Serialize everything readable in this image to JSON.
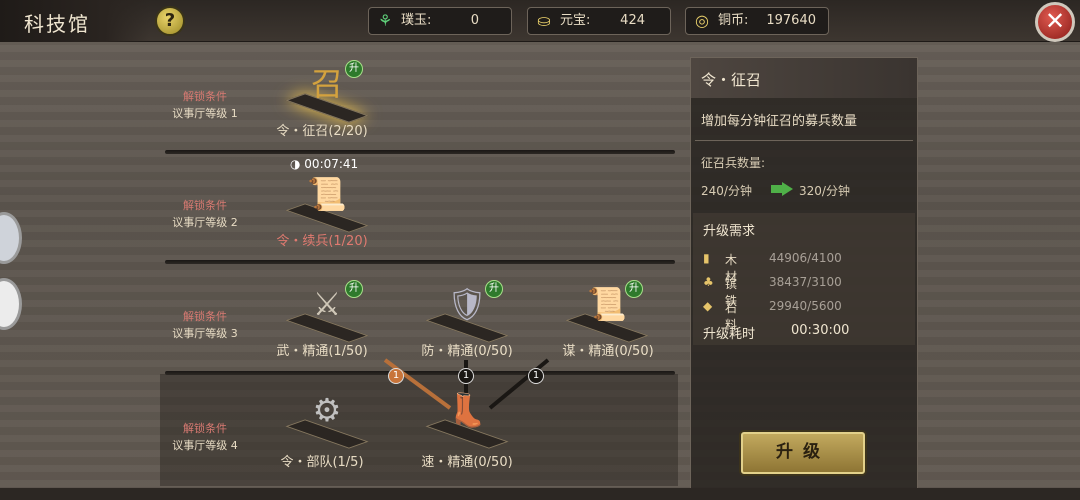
{
  "header": {
    "title": "科技馆",
    "help_label": "?",
    "close_label": "✕"
  },
  "resources": [
    {
      "icon": "jade-icon",
      "glyph": "⚘",
      "label": "璞玉:",
      "value": "0"
    },
    {
      "icon": "ingot-icon",
      "glyph": "⛀",
      "label": "元宝:",
      "value": "424"
    },
    {
      "icon": "copper-coin-icon",
      "glyph": "◎",
      "label": "铜币:",
      "value": "197640"
    }
  ],
  "tiers": [
    {
      "cond": "解锁条件",
      "req": "议事厅等级 1"
    },
    {
      "cond": "解锁条件",
      "req": "议事厅等级 2"
    },
    {
      "cond": "解锁条件",
      "req": "议事厅等级 3"
    },
    {
      "cond": "解锁条件",
      "req": "议事厅等级 4"
    }
  ],
  "nodes": {
    "summon": {
      "label": "令・征召(2/20)",
      "glyph": "召",
      "upgrade_badge": "升"
    },
    "reinforce": {
      "label": "令・续兵(1/20)",
      "glyph": "📜",
      "timer": "00:07:41"
    },
    "martial": {
      "label": "武・精通(1/50)",
      "glyph": "⚔",
      "upgrade_badge": "升"
    },
    "defense": {
      "label": "防・精通(0/50)",
      "glyph": "🛡",
      "upgrade_badge": "升"
    },
    "strategy": {
      "label": "谋・精通(0/50)",
      "glyph": "📜",
      "upgrade_badge": "升"
    },
    "troops": {
      "label": "令・部队(1/5)",
      "glyph": "⚙"
    },
    "speed": {
      "label": "速・精通(0/50)",
      "glyph": "👢"
    }
  },
  "links": {
    "badge_martial": "1",
    "badge_defense": "1",
    "badge_strategy": "1"
  },
  "panel": {
    "title": "令・征召",
    "description": "增加每分钟征召的募兵数量",
    "stat_label": "征召兵数量:",
    "stat_current": "240/分钟",
    "stat_next": "320/分钟",
    "req_title": "升级需求",
    "requirements": [
      {
        "icon": "wood-icon",
        "glyph": "▮",
        "name": "木材",
        "value": "44906/4100"
      },
      {
        "icon": "iron-icon",
        "glyph": "♣",
        "name": "镔铁",
        "value": "38437/3100"
      },
      {
        "icon": "stone-icon",
        "glyph": "◆",
        "name": "石料",
        "value": "29940/5600"
      }
    ],
    "time_label": "升级耗时",
    "time_value": "00:30:00",
    "upgrade_button": "升级"
  }
}
